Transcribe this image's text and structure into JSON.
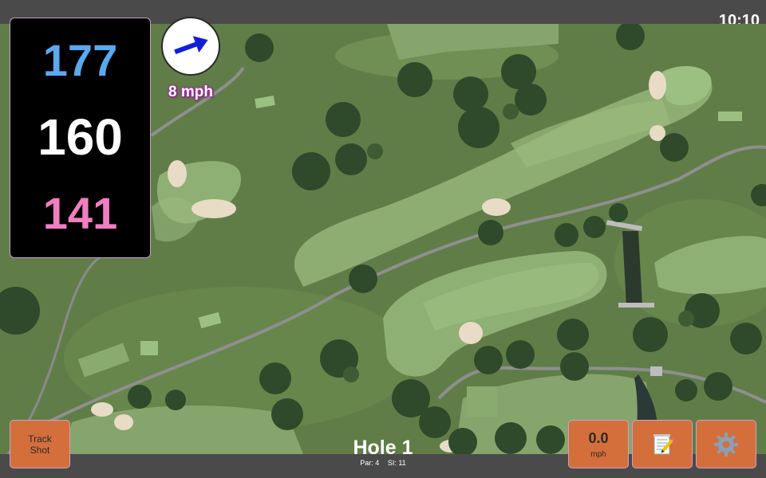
{
  "status": {
    "clock": "10:10"
  },
  "distances": {
    "back": "177",
    "middle": "160",
    "front": "141"
  },
  "wind": {
    "speed": "8 mph",
    "arrow_icon": "arrow-right-icon",
    "direction_deg": -20
  },
  "buttons": {
    "track_shot": "Track\nShot",
    "speed_value": "0.0",
    "speed_unit": "mph",
    "notes_icon": "notepad-icon",
    "settings_icon": "gear-icon"
  },
  "hole": {
    "title": "Hole 1",
    "par": "Par: 4",
    "si": "SI: 11"
  },
  "colors": {
    "back": "#5aa9f0",
    "middle": "#ffffff",
    "front": "#f07ec0",
    "button": "#d46f3c",
    "wind_arrow": "#1020d8"
  }
}
